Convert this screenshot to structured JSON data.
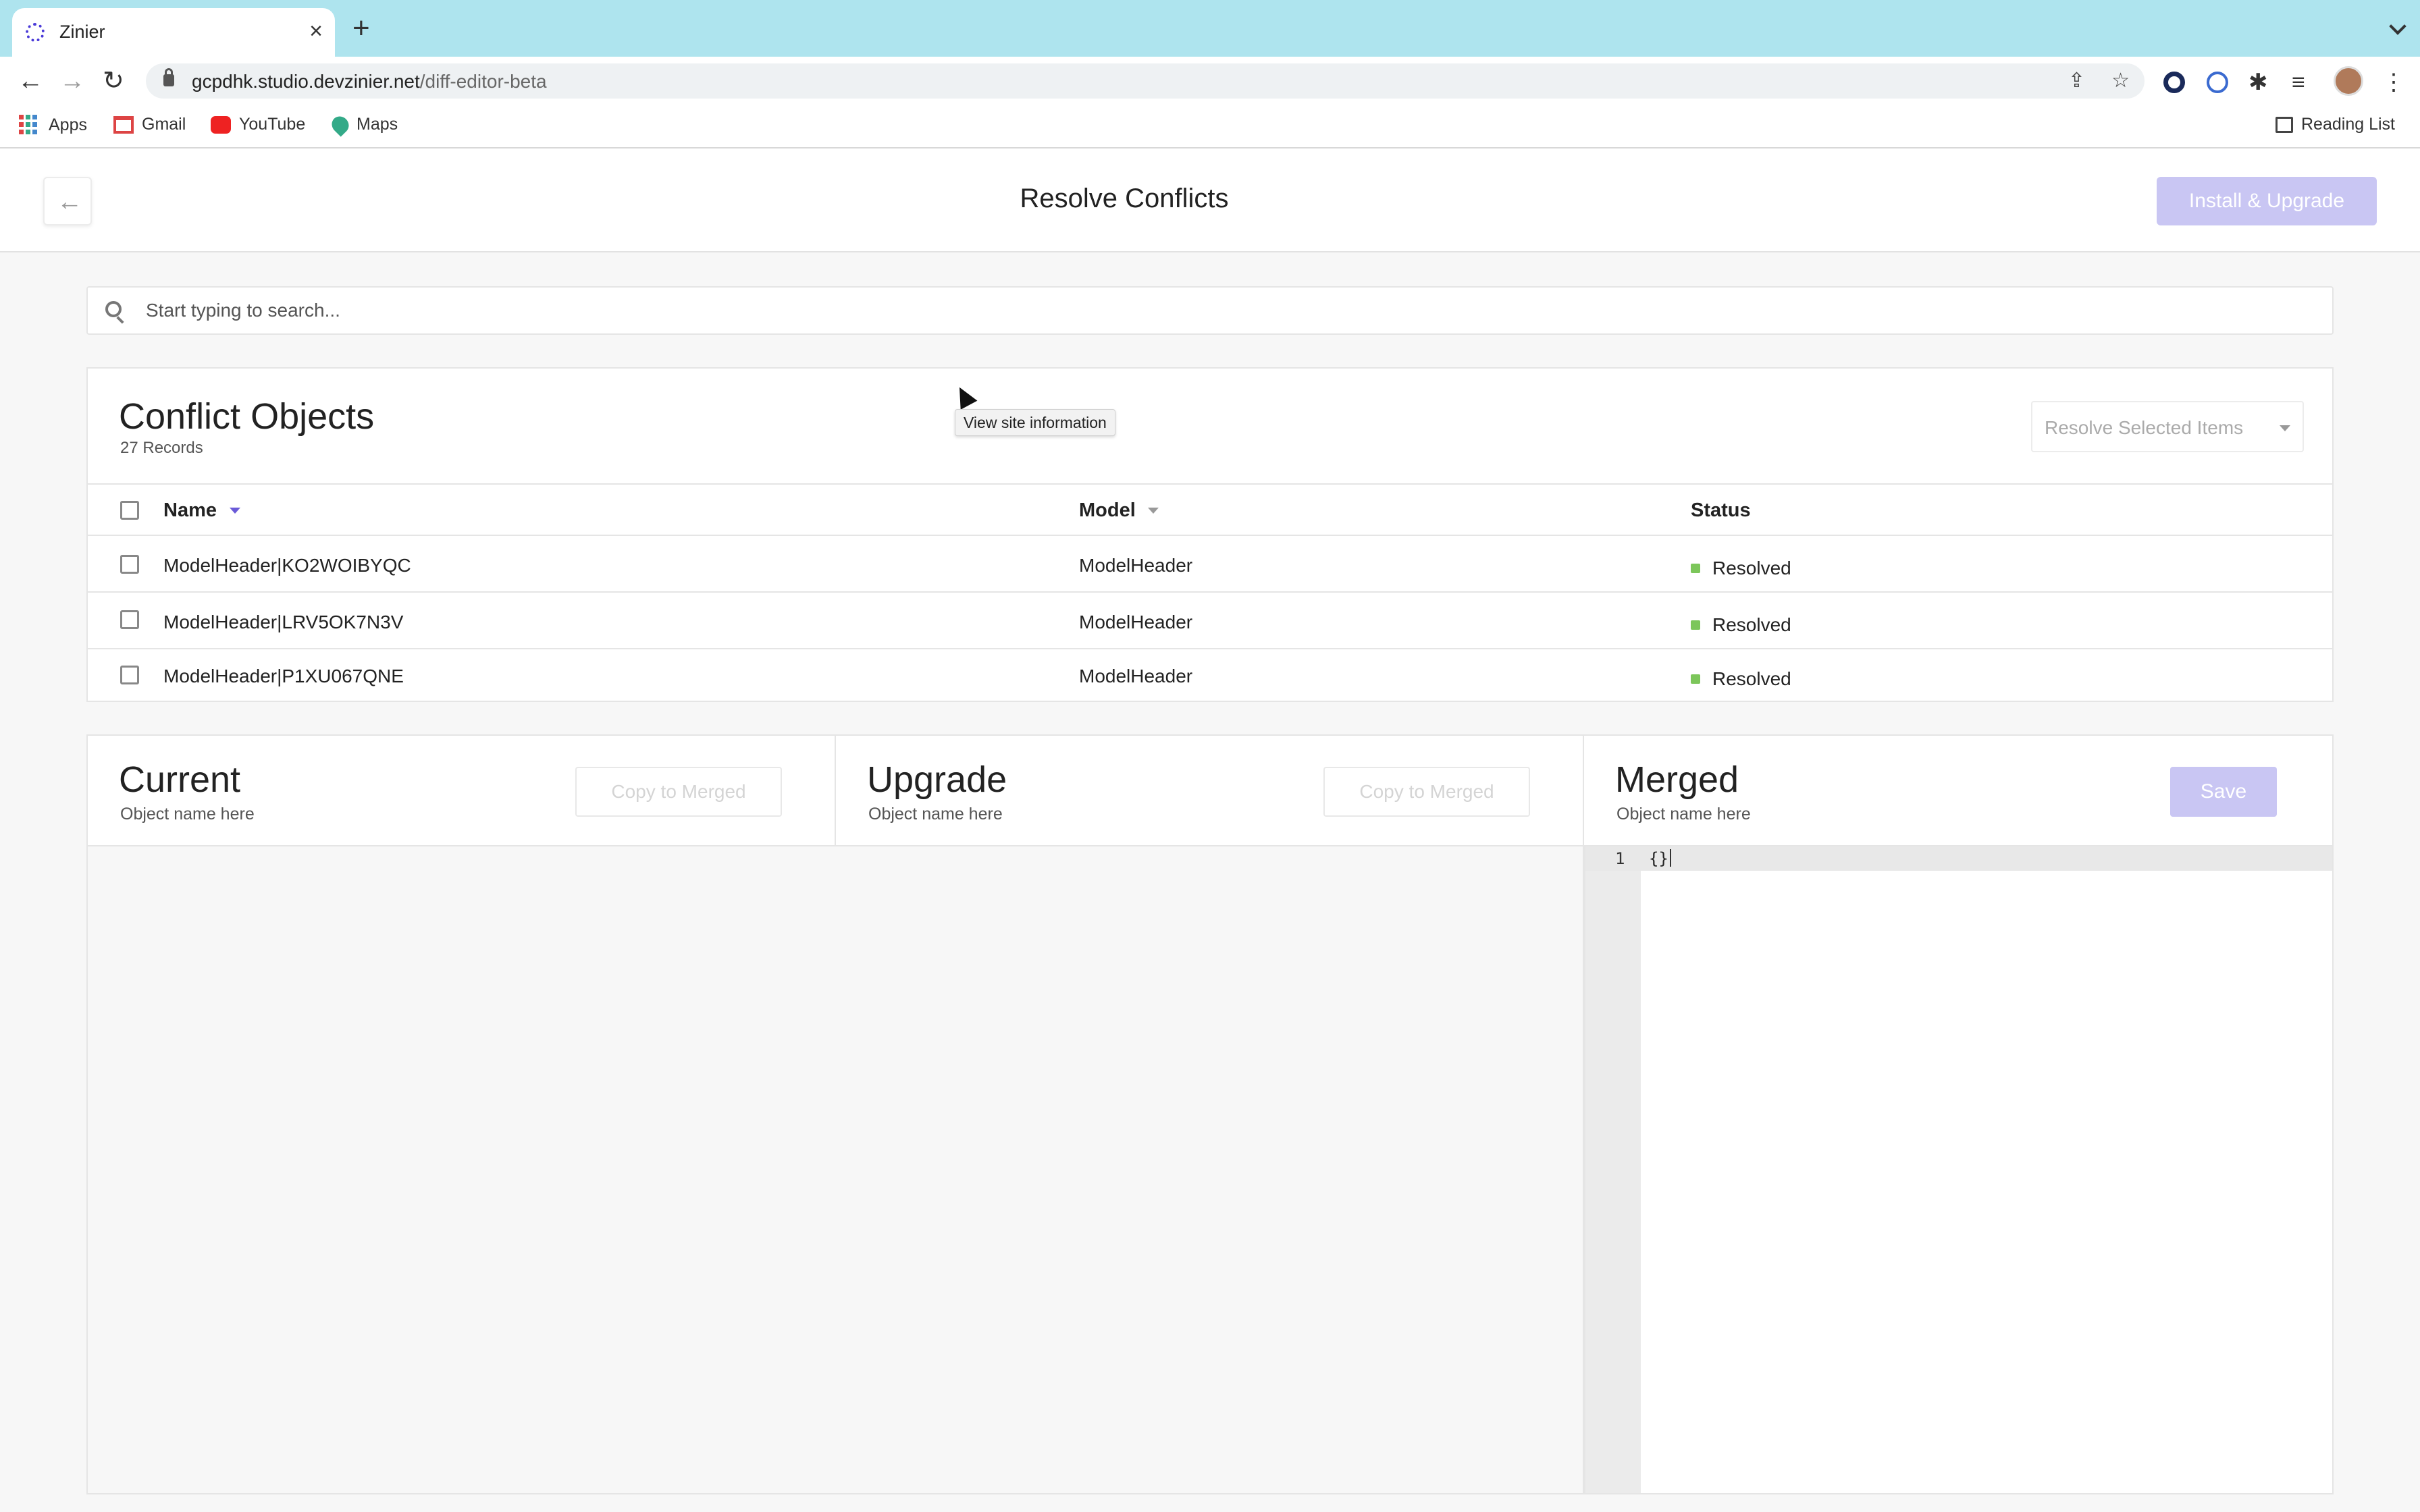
{
  "browser": {
    "tab_title": "Zinier",
    "url_host": "gcpdhk.studio.devzinier.net",
    "url_path": "/diff-editor-beta",
    "bookmarks": [
      "Apps",
      "Gmail",
      "YouTube",
      "Maps"
    ],
    "reading_list": "Reading List"
  },
  "header": {
    "title": "Resolve Conflicts",
    "install_label": "Install & Upgrade"
  },
  "search": {
    "placeholder": "Start typing to search..."
  },
  "tooltip": "View site information",
  "conflicts": {
    "title": "Conflict Objects",
    "count": "27 Records",
    "resolve_select": "Resolve Selected Items",
    "columns": {
      "name": "Name",
      "model": "Model",
      "status": "Status"
    },
    "rows": [
      {
        "name": "ModelHeader|KO2WOIBYQC",
        "model": "ModelHeader",
        "status": "Resolved"
      },
      {
        "name": "ModelHeader|LRV5OK7N3V",
        "model": "ModelHeader",
        "status": "Resolved"
      },
      {
        "name": "ModelHeader|P1XU067QNE",
        "model": "ModelHeader",
        "status": "Resolved"
      }
    ]
  },
  "panels": {
    "current": {
      "title": "Current",
      "subtitle": "Object name here",
      "copy_label": "Copy to Merged"
    },
    "upgrade": {
      "title": "Upgrade",
      "subtitle": "Object name here",
      "copy_label": "Copy to Merged"
    },
    "merged": {
      "title": "Merged",
      "subtitle": "Object name here",
      "save_label": "Save"
    }
  },
  "editor": {
    "line_number": "1",
    "content": "{}"
  },
  "colors": {
    "accent": "#c9c6f3",
    "status_resolved": "#7cc65a",
    "tab_bar": "#aee4ee"
  }
}
